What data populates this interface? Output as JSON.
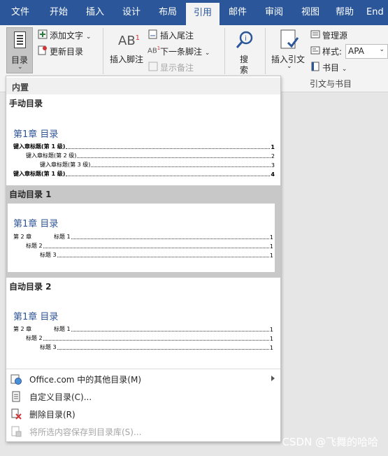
{
  "tabs": [
    "文件",
    "开始",
    "插入",
    "设计",
    "布局",
    "引用",
    "邮件",
    "审阅",
    "视图",
    "帮助",
    "End"
  ],
  "ribbon": {
    "toc_label": "目录",
    "add_text": "添加文字",
    "update_toc": "更新目录",
    "insert_footnote_ab": "AB",
    "insert_footnote_sup": "1",
    "insert_footnote": "插入脚注",
    "insert_endnote": "插入尾注",
    "next_footnote": "下一条脚注",
    "show_notes": "显示备注",
    "search_1": "搜",
    "search_2": "索",
    "insert_citation": "插入引文",
    "manage_sources": "管理源",
    "style_label": "样式:",
    "style_value": "APA",
    "bibliography": "书目",
    "group_citations": "引文与书目"
  },
  "panel": {
    "builtin_header": "内置",
    "manual_title": "手动目录",
    "manual_heading": "第1章 目录",
    "manual_lines": [
      {
        "text": "键入章标题(第 1 级)",
        "page": "1"
      },
      {
        "text": "键入章标题(第 2 级)",
        "page": "2"
      },
      {
        "text": "键入章标题(第 3 级)",
        "page": "3"
      },
      {
        "text": "键入章标题(第 1 级)",
        "page": "4"
      }
    ],
    "auto1_title": "自动目录 1",
    "auto1_heading": "第1章 目录",
    "auto2_title": "自动目录 2",
    "auto2_heading": "第1章 目录",
    "auto_lines": [
      {
        "prefix": "第 2 章",
        "text": "标题 1",
        "page": "1"
      },
      {
        "prefix": "",
        "text": "标题 2",
        "page": "1"
      },
      {
        "prefix": "",
        "text": "标题 3",
        "page": "1"
      }
    ],
    "menu": {
      "more_toc": "Office.com 中的其他目录(M)",
      "custom_toc": "自定义目录(C)...",
      "remove_toc": "删除目录(R)",
      "save_selection": "将所选内容保存到目录库(S)..."
    }
  },
  "watermark": "CSDN @飞舞的哈哈",
  "colors": {
    "ribbon_blue": "#2b579a",
    "heading_blue": "#2f5597",
    "selected_gray": "#c8c8c8"
  }
}
